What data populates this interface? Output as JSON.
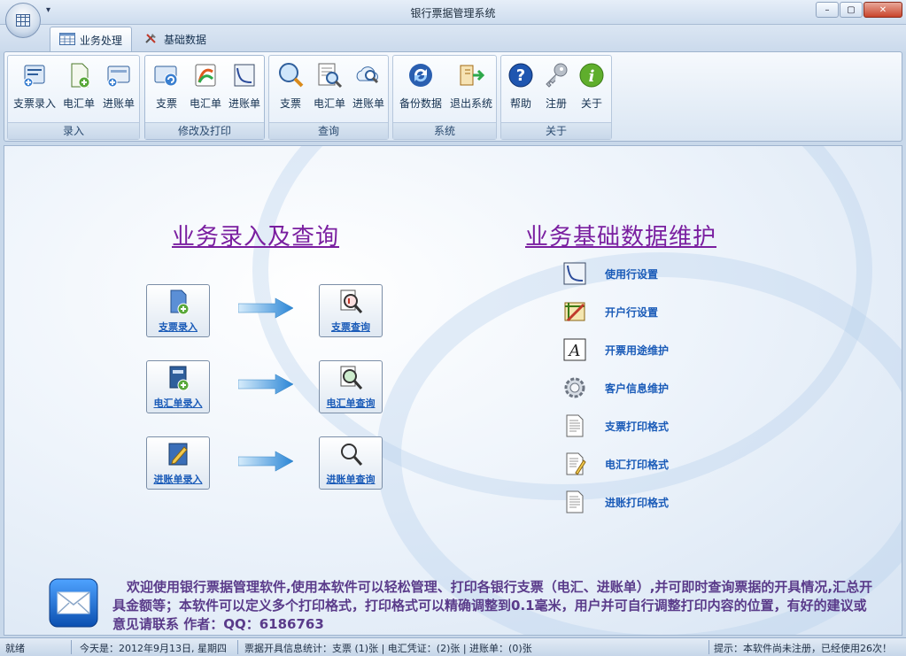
{
  "window": {
    "title": "银行票据管理系统",
    "qa_glyph": "▾",
    "minimize_glyph": "–",
    "restore_glyph": "▢",
    "close_glyph": "✕"
  },
  "tabs": [
    {
      "label": "业务处理",
      "active": true
    },
    {
      "label": "基础数据",
      "active": false
    }
  ],
  "ribbon": {
    "groups": [
      {
        "label": "录入",
        "buttons": [
          "支票录入",
          "电汇单",
          "进账单"
        ]
      },
      {
        "label": "修改及打印",
        "buttons": [
          "支票",
          "电汇单",
          "进账单"
        ]
      },
      {
        "label": "查询",
        "buttons": [
          "支票",
          "电汇单",
          "进账单"
        ]
      },
      {
        "label": "系统",
        "buttons": [
          "备份数据",
          "退出系统"
        ]
      },
      {
        "label": "关于",
        "buttons": [
          "帮助",
          "注册",
          "关于"
        ]
      }
    ]
  },
  "main": {
    "left_heading": "业务录入及查询",
    "right_heading": "业务基础数据维护",
    "entry_tiles": [
      "支票录入",
      "电汇单录入",
      "进账单录入"
    ],
    "query_tiles": [
      "支票查询",
      "电汇单查询",
      "进账单查询"
    ],
    "maintenance": [
      {
        "label": "使用行设置",
        "icon": "curve-icon"
      },
      {
        "label": "开户行设置",
        "icon": "ruler-pencil-icon"
      },
      {
        "label": "开票用途维护",
        "icon": "font-a-icon"
      },
      {
        "label": "客户信息维护",
        "icon": "gear-icon"
      },
      {
        "label": "支票打印格式",
        "icon": "document-icon"
      },
      {
        "label": "电汇打印格式",
        "icon": "document-pencil-icon"
      },
      {
        "label": "进账打印格式",
        "icon": "document-icon"
      }
    ],
    "welcome_text": "欢迎使用银行票据管理软件,使用本软件可以轻松管理、打印各银行支票（电汇、进账单）,并可即时查询票据的开具情况,汇总开具金额等；本软件可以定义多个打印格式，打印格式可以精确调整到0.1毫米，用户并可自行调整打印内容的位置，有好的建议或意见请联系  作者：QQ：6186763"
  },
  "status": {
    "ready": "就绪",
    "date": "今天是：2012年9月13日, 星期四",
    "stats": "票据开具信息统计：支票 (1)张 | 电汇凭证：(2)张 | 进账单：(0)张",
    "hint": "提示：本软件尚未注册，已经使用26次！"
  },
  "colors": {
    "heading": "#7a1fa0",
    "link": "#1a5bb8",
    "welcome": "#5a3b8a"
  }
}
